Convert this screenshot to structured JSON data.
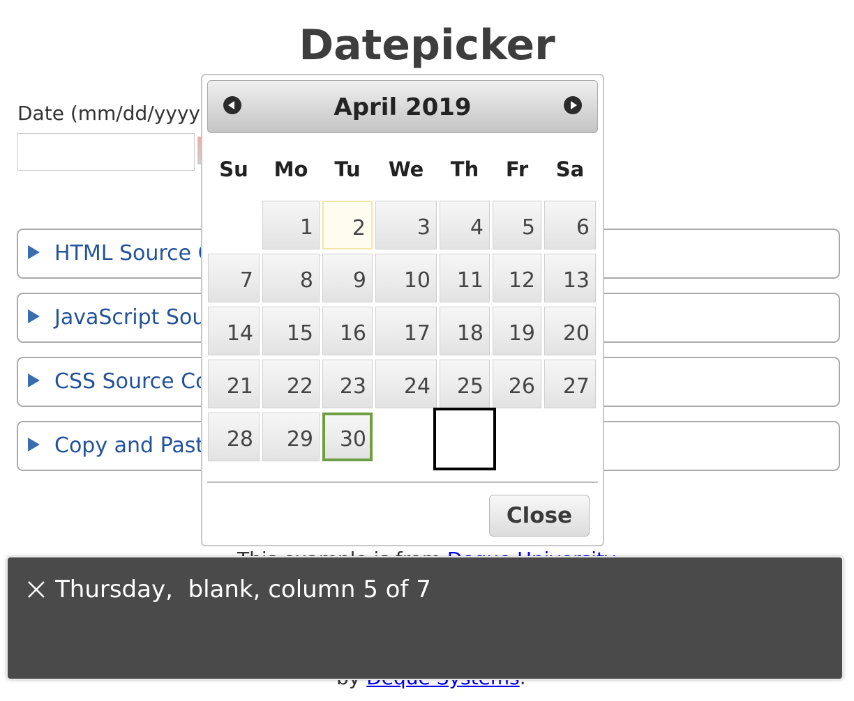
{
  "page": {
    "title": "Datepicker",
    "date_label": "Date (mm/dd/yyyy)",
    "date_value": ""
  },
  "accordions": [
    {
      "label": "HTML Source Code"
    },
    {
      "label": "JavaScript Source Code"
    },
    {
      "label": "CSS Source Code"
    },
    {
      "label": "Copy and Paste Code"
    }
  ],
  "footer": {
    "line1_prefix": "This example is from",
    "line1_link": "Deque University",
    "line2_prefix": "by",
    "line2_link": "Deque Systems",
    "line2_suffix": "."
  },
  "datepicker": {
    "month_label": "April 2019",
    "prev_icon": "circle-arrow-left-icon",
    "next_icon": "circle-arrow-right-icon",
    "weekdays": [
      "Su",
      "Mo",
      "Tu",
      "We",
      "Th",
      "Fr",
      "Sa"
    ],
    "weeks": [
      [
        "",
        "1",
        "2",
        "3",
        "4",
        "5",
        "6"
      ],
      [
        "7",
        "8",
        "9",
        "10",
        "11",
        "12",
        "13"
      ],
      [
        "14",
        "15",
        "16",
        "17",
        "18",
        "19",
        "20"
      ],
      [
        "21",
        "22",
        "23",
        "24",
        "25",
        "26",
        "27"
      ],
      [
        "28",
        "29",
        "30",
        "",
        "",
        "",
        ""
      ]
    ],
    "today": "2",
    "selected": "30",
    "close_label": "Close"
  },
  "screen_reader": {
    "close_icon": "close-x-icon",
    "announcement": "Thursday,  blank, column 5 of 7"
  },
  "colors": {
    "link": "#24529a",
    "selected_border": "#6e9d43",
    "today_background": "#fffdf0",
    "panel_background": "#4a4a4a"
  }
}
